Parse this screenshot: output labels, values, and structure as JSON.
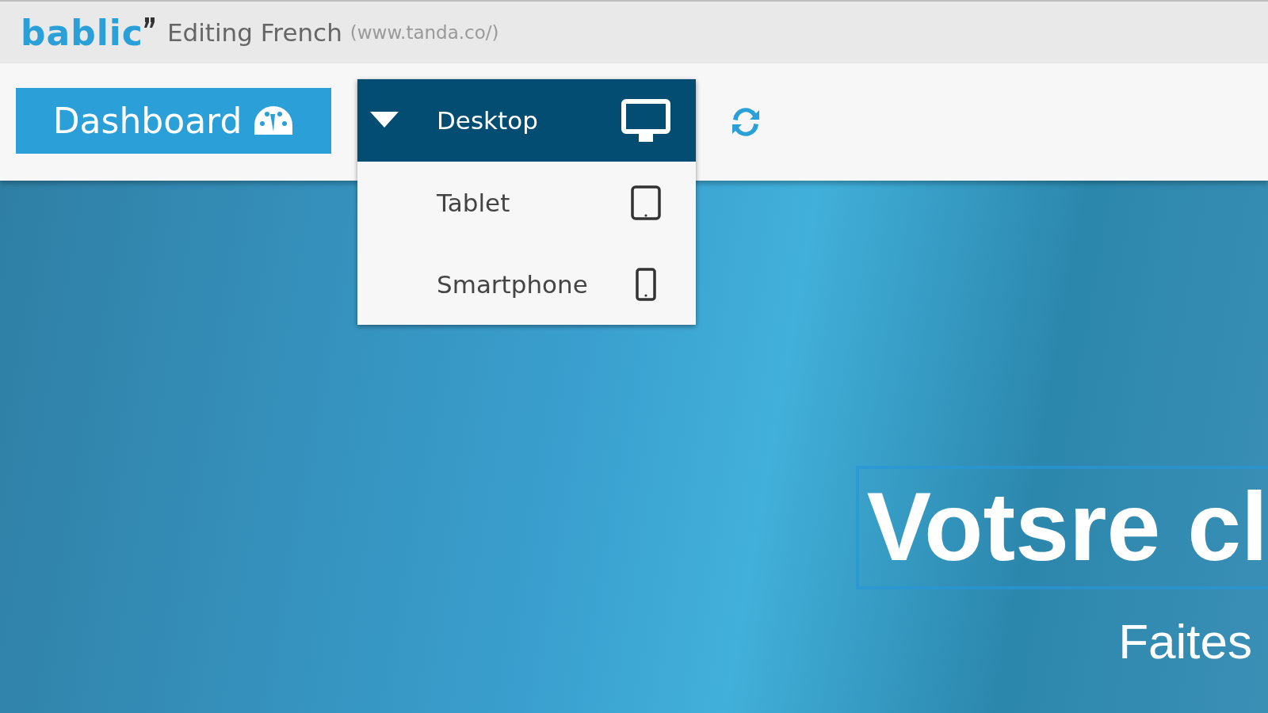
{
  "header": {
    "logo": "bablic",
    "title": "Editing French",
    "url": "(www.tanda.co/)"
  },
  "toolbar": {
    "dashboard_button": "Dashboard"
  },
  "device_menu": {
    "items": [
      {
        "label": "Desktop",
        "kind": "desktop",
        "selected": true
      },
      {
        "label": "Tablet",
        "kind": "tablet",
        "selected": false
      },
      {
        "label": "Smartphone",
        "kind": "smartphone",
        "selected": false
      }
    ]
  },
  "hero": {
    "heading": "Votsre cl",
    "subheading": "Faites"
  }
}
